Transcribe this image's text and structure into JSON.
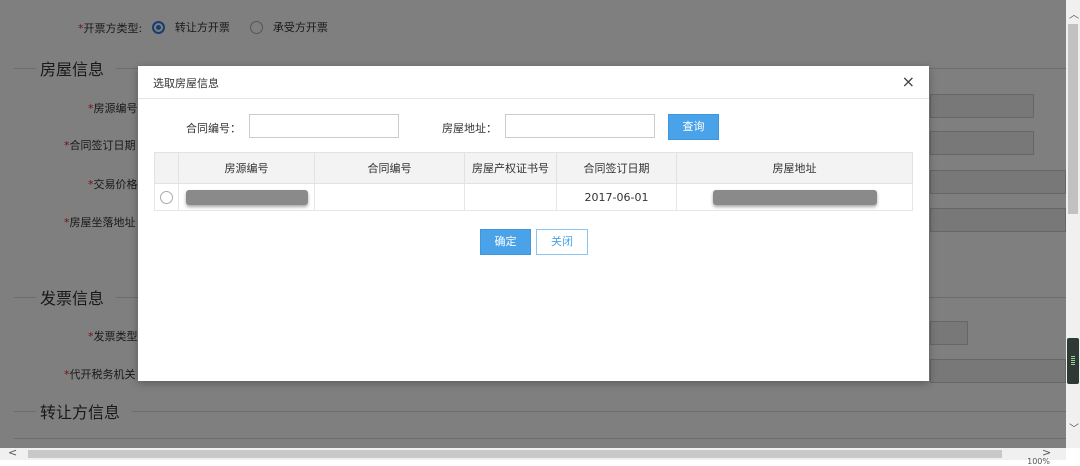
{
  "background": {
    "invoice_issuer": {
      "label": "开票方类型:",
      "options": [
        {
          "label": "转让方开票",
          "selected": true
        },
        {
          "label": "承受方开票",
          "selected": false
        }
      ]
    },
    "sections": [
      {
        "title": "房屋信息"
      },
      {
        "title": "发票信息"
      },
      {
        "title": "转让方信息"
      }
    ],
    "house_fields": [
      "房源编号",
      "合同签订日期",
      "交易价格",
      "房屋坐落地址"
    ],
    "invoice_fields": [
      "发票类型",
      "代开税务机关"
    ]
  },
  "modal": {
    "title": "选取房屋信息",
    "close_glyph": "×",
    "search": {
      "contract_no_label": "合同编号：",
      "contract_no_value": "",
      "address_label": "房屋地址：",
      "address_value": "",
      "query_button": "查询"
    },
    "table": {
      "columns": [
        "房源编号",
        "合同编号",
        "房屋产权证书号",
        "合同签订日期",
        "房屋地址"
      ],
      "rows": [
        {
          "house_no": "",
          "contract_no": "",
          "certificate_no": "",
          "sign_date": "2017-06-01",
          "address": ""
        }
      ]
    },
    "confirm_button": "确定",
    "cancel_button": "关闭"
  },
  "status_bar": {
    "zoom": "100%"
  },
  "colors": {
    "primary": "#4aa3e8",
    "required": "#e0262b",
    "overlay": "rgba(0,0,0,0.5)"
  }
}
